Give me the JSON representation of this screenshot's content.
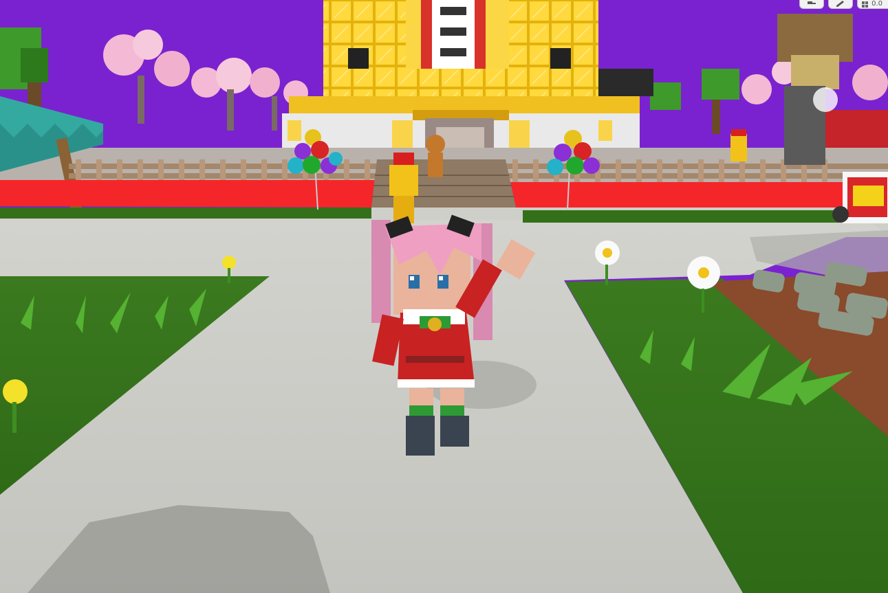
{
  "game": {
    "scene": "plaza",
    "hud": {
      "buttons": [
        {
          "name": "hud-tool-button",
          "icon": "hammer-icon"
        },
        {
          "name": "hud-edit-button",
          "icon": "pencil-icon"
        }
      ],
      "readout_icon": "grid-icon",
      "readout_text": "0.0"
    },
    "colors": {
      "sky": "#7a22d0",
      "path": "#c9c9c4",
      "grass": "#3f7d22",
      "carpet": "#f5262a",
      "castle_gold": "#f3c523",
      "castle_wall": "#e9e9ea"
    }
  }
}
